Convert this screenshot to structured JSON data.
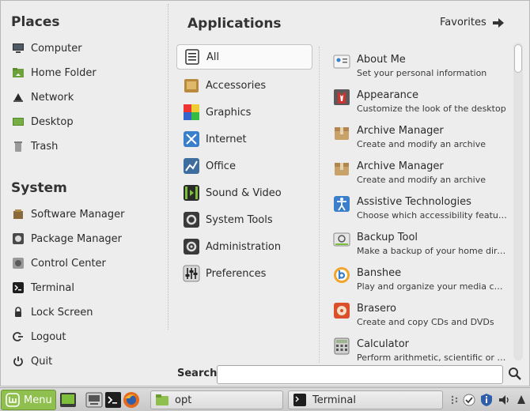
{
  "places": {
    "title": "Places",
    "items": [
      {
        "label": "Computer",
        "icon": "computer-icon"
      },
      {
        "label": "Home Folder",
        "icon": "home-folder-icon"
      },
      {
        "label": "Network",
        "icon": "network-icon"
      },
      {
        "label": "Desktop",
        "icon": "desktop-icon"
      },
      {
        "label": "Trash",
        "icon": "trash-icon"
      }
    ]
  },
  "system": {
    "title": "System",
    "items": [
      {
        "label": "Software Manager",
        "icon": "software-manager-icon"
      },
      {
        "label": "Package Manager",
        "icon": "package-manager-icon"
      },
      {
        "label": "Control Center",
        "icon": "control-center-icon"
      },
      {
        "label": "Terminal",
        "icon": "terminal-icon"
      },
      {
        "label": "Lock Screen",
        "icon": "lock-icon"
      },
      {
        "label": "Logout",
        "icon": "logout-icon"
      },
      {
        "label": "Quit",
        "icon": "power-icon"
      }
    ]
  },
  "applications": {
    "title": "Applications",
    "favorites_label": "Favorites",
    "categories": [
      {
        "label": "All",
        "selected": true
      },
      {
        "label": "Accessories"
      },
      {
        "label": "Graphics"
      },
      {
        "label": "Internet"
      },
      {
        "label": "Office"
      },
      {
        "label": "Sound & Video"
      },
      {
        "label": "System Tools"
      },
      {
        "label": "Administration"
      },
      {
        "label": "Preferences"
      }
    ],
    "apps": [
      {
        "name": "About Me",
        "desc": "Set your personal information"
      },
      {
        "name": "Appearance",
        "desc": "Customize the look of the desktop"
      },
      {
        "name": "Archive Manager",
        "desc": "Create and modify an archive"
      },
      {
        "name": "Archive Manager",
        "desc": "Create and modify an archive"
      },
      {
        "name": "Assistive Technologies",
        "desc": "Choose which accessibility features t..."
      },
      {
        "name": "Backup Tool",
        "desc": "Make a backup of your home directory"
      },
      {
        "name": "Banshee",
        "desc": "Play and organize your media collect..."
      },
      {
        "name": "Brasero",
        "desc": "Create and copy CDs and DVDs"
      },
      {
        "name": "Calculator",
        "desc": "Perform arithmetic, scientific or fina..."
      }
    ]
  },
  "search": {
    "label": "Search:",
    "value": ""
  },
  "panel": {
    "menu_label": "Menu",
    "tasks": [
      {
        "label": "opt"
      },
      {
        "label": "Terminal"
      }
    ]
  },
  "colors": {
    "menu_green": "#8fbf4e",
    "accent_blue": "#3a7fc9"
  }
}
